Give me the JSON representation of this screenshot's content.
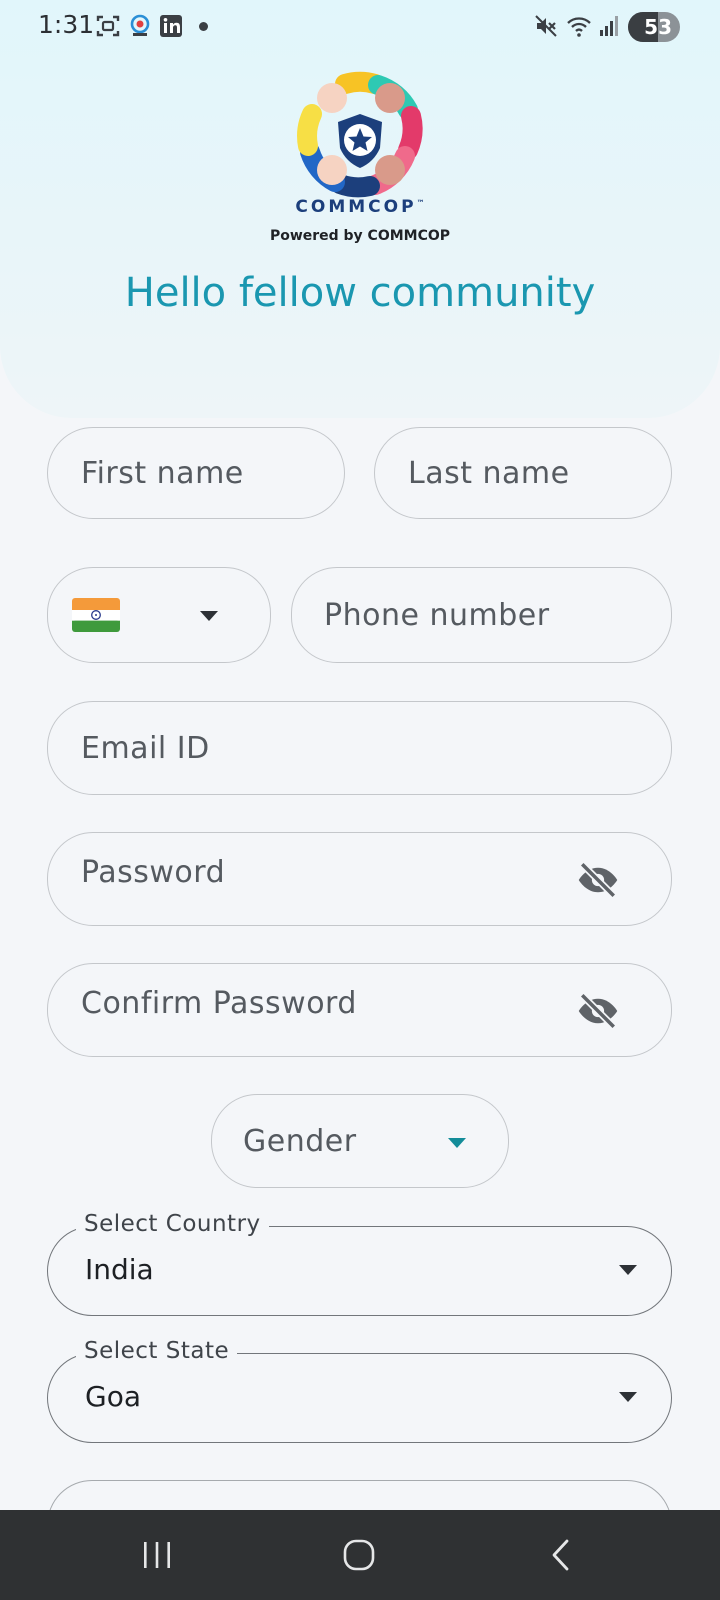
{
  "status_bar": {
    "time": "1:31",
    "battery": "53",
    "icons": [
      "screenshot-icon",
      "app-notification-icon",
      "linkedin-icon",
      "mute-icon",
      "wifi-icon",
      "signal-icon",
      "battery-icon"
    ]
  },
  "branding": {
    "logo_name": "COMMCOP",
    "trademark": "™",
    "powered_by": "Powered by COMMCOP",
    "greeting": "Hello fellow community"
  },
  "form": {
    "first_name": {
      "placeholder": "First name"
    },
    "last_name": {
      "placeholder": "Last name"
    },
    "phone_country": {
      "flag": "🇮🇳"
    },
    "phone": {
      "placeholder": "Phone number"
    },
    "email": {
      "placeholder": "Email ID"
    },
    "password": {
      "placeholder": "Password"
    },
    "confirm_password": {
      "placeholder": "Confirm Password"
    },
    "gender": {
      "placeholder": "Gender"
    },
    "country": {
      "label": "Select Country",
      "value": "India"
    },
    "state": {
      "label": "Select State",
      "value": "Goa"
    }
  },
  "colors": {
    "accent": "#1a97b0",
    "brand_navy": "#1c3f7c",
    "background": "#f4f6f9",
    "nav_bar": "#2f3133"
  },
  "nav_bar": {
    "buttons": [
      "recent-apps-icon",
      "home-icon",
      "back-icon"
    ]
  }
}
